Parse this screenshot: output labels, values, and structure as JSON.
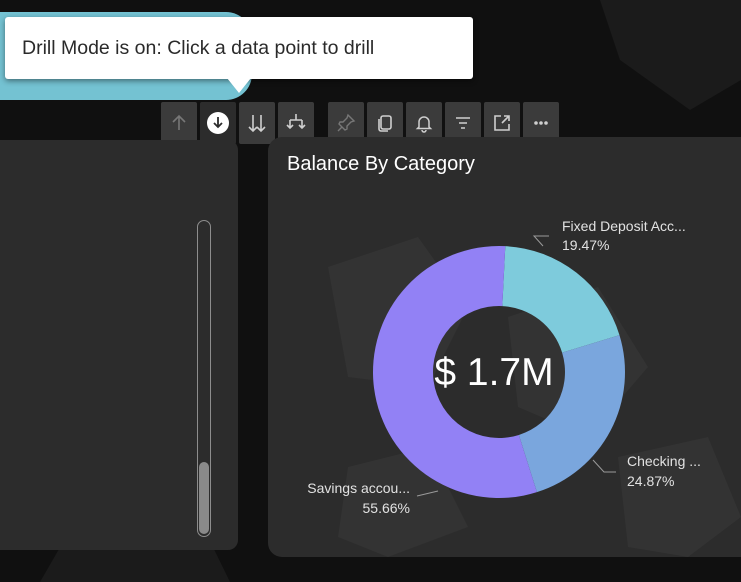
{
  "tooltip": {
    "text": "Drill Mode is on: Click a data point to drill"
  },
  "toolbar": {
    "buttons": [
      {
        "icon": "drill-up-icon"
      },
      {
        "icon": "drill-down-icon"
      },
      {
        "icon": "next-level-icon"
      },
      {
        "icon": "expand-hierarchy-icon"
      },
      {
        "icon": "pin-icon"
      },
      {
        "icon": "copy-icon"
      },
      {
        "icon": "bell-icon"
      },
      {
        "icon": "filter-icon"
      },
      {
        "icon": "focus-mode-icon"
      },
      {
        "icon": "more-options-icon"
      }
    ]
  },
  "chart_data": {
    "type": "donut",
    "title": "Balance By Category",
    "center_value": "$ 1.7M",
    "slices": [
      {
        "label": "Fixed Deposit Acc...",
        "percent_label": "19.47%",
        "value": 19.47,
        "color": "#7ecbdc"
      },
      {
        "label": "Checking ...",
        "percent_label": "24.87%",
        "value": 24.87,
        "color": "#7aa6dd"
      },
      {
        "label": "Savings accou...",
        "percent_label": "55.66%",
        "value": 55.66,
        "color": "#9281f5"
      }
    ]
  }
}
